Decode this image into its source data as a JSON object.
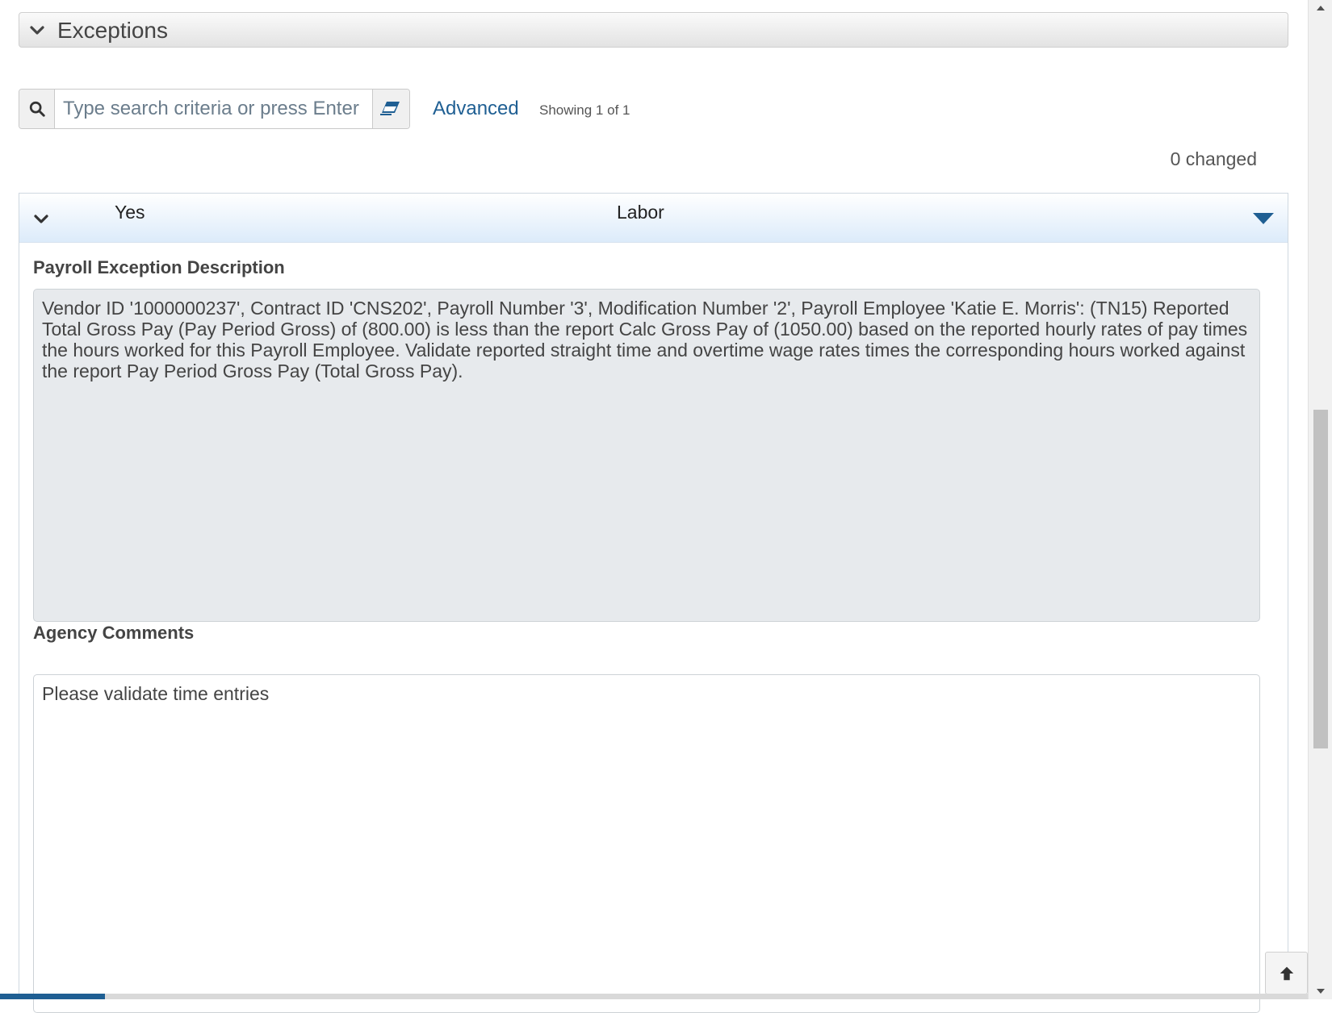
{
  "panel": {
    "title": "Exceptions"
  },
  "search": {
    "placeholder": "Type search criteria or press Enter",
    "value": "",
    "advanced_label": "Advanced",
    "showing_text": "Showing 1 of 1"
  },
  "changed_text": "0 changed",
  "record": {
    "col1": "Yes",
    "col2": "Labor",
    "description_label": "Payroll Exception Description",
    "description": "Vendor ID '1000000237', Contract ID 'CNS202', Payroll Number '3', Modification Number '2', Payroll Employee 'Katie E. Morris': (TN15) Reported Total Gross Pay (Pay Period Gross) of (800.00) is less than the report  Calc Gross Pay of (1050.00) based on the reported hourly rates of pay times the hours worked for this Payroll Employee.  Validate reported straight time and overtime wage rates times the corresponding hours worked against the report Pay Period Gross  Pay (Total Gross Pay).",
    "comments_label": "Agency Comments",
    "comments_value": "Please validate time entries"
  },
  "icons": {
    "panel_toggle": "chevron-down-icon",
    "search": "search-icon",
    "clear": "eraser-icon",
    "record_toggle": "chevron-down-icon",
    "record_menu": "caret-down-icon",
    "back_to_top": "arrow-up-icon"
  },
  "colors": {
    "accent": "#1f5f93",
    "record_header": "#dcebfa",
    "description_bg": "#e7eaed"
  }
}
